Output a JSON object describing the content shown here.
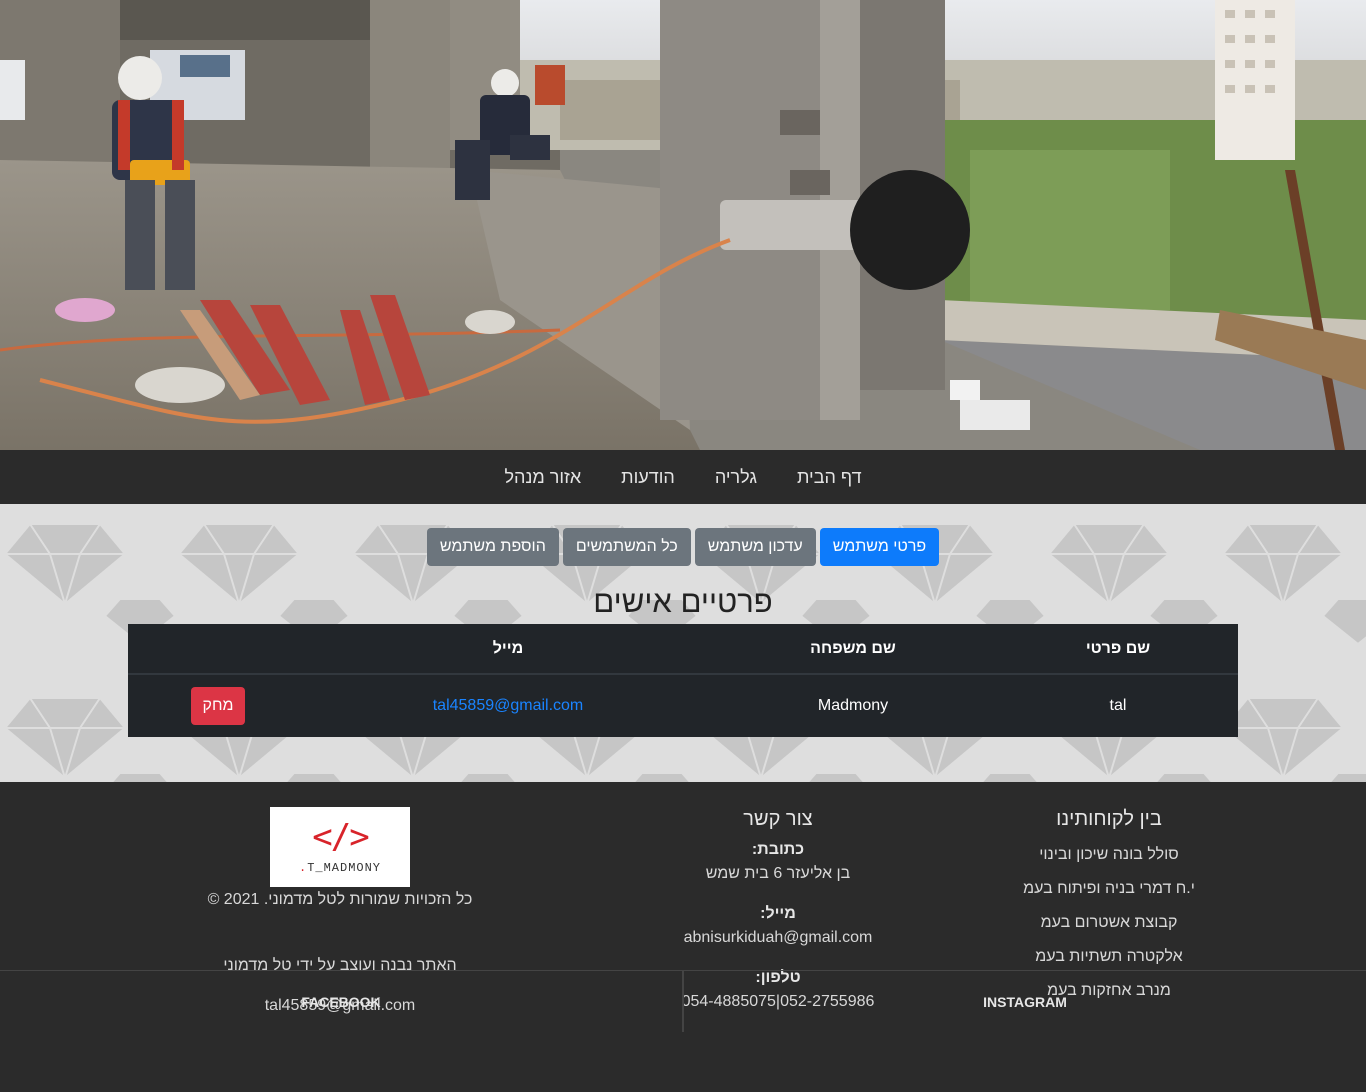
{
  "nav": {
    "items": [
      "דף הבית",
      "גלריה",
      "הודעות",
      "אזור מנהל"
    ]
  },
  "actions": {
    "user_details": "פרטי משתמש",
    "update_user": "עדכון משתמש",
    "all_users": "כל המשתמשים",
    "add_user": "הוספת משתמש"
  },
  "profile": {
    "heading": "פרטיים אישים",
    "columns": {
      "first_name": "שם פרטי",
      "last_name": "שם משפחה",
      "email": "מייל"
    },
    "row": {
      "first_name": "tal",
      "last_name": "Madmony",
      "email": "tal45859@gmail.com",
      "delete_label": "מחק"
    }
  },
  "footer": {
    "clients": {
      "title": "בין לקוחותינו",
      "items": [
        "סולל בונה שיכון ובינוי",
        "י.ח דמרי בניה ופיתוח בעמ",
        "קבוצת אשטרום בעמ",
        "אלקטרה תשתיות בעמ",
        "מנרב אחזקות בעמ"
      ]
    },
    "contact": {
      "title": "צור קשר",
      "address_label": "כתובת:",
      "address": "בן אליעזר 6 בית שמש",
      "email_label": "מייל:",
      "email": "abnisurkiduah@gmail.com",
      "phone_label": "טלפון:",
      "phone": "052-2755986|054-4885075"
    },
    "about": {
      "logo_glyph": "</>",
      "logo_text": "T_MADMONY",
      "copyright": "כל הזכויות שמורות לטל מדמוני.  2021  ©",
      "built_by": "האתר נבנה ועוצב על ידי טל מדמוני",
      "email": "tal45859@gmail.com"
    },
    "social": {
      "instagram": "INSTAGRAM",
      "facebook": "FACEBOOK"
    }
  },
  "colors": {
    "primary": "#0d7bfb",
    "secondary": "#6c757d",
    "danger": "#dc3545",
    "table_bg": "#212529",
    "page_dark": "#2b2b2b"
  }
}
